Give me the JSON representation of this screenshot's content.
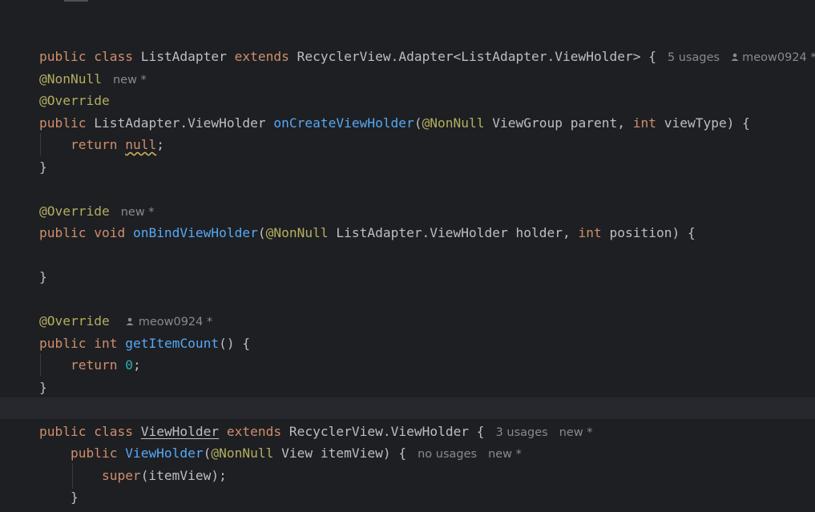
{
  "colors": {
    "background": "#1e1f22",
    "keyword": "#cf8e6d",
    "annotation": "#b3ae60",
    "method": "#56a8f5",
    "number": "#2aacb8",
    "text": "#bcbec4",
    "hint": "#868a91"
  },
  "code": {
    "class_decl": {
      "kw_public": "public",
      "kw_class": "class",
      "name": "ListAdapter",
      "kw_extends": "extends",
      "parent": "RecyclerView.Adapter<ListAdapter.ViewHolder>",
      "brace": "{",
      "hint_usages": "5 usages",
      "hint_author": "meow0924 *"
    },
    "m1": {
      "ann_nonnull": "@NonNull",
      "hint_new": "new *",
      "ann_override": "@Override",
      "kw_public": "public",
      "return_type": "ListAdapter.ViewHolder",
      "name": "onCreateViewHolder",
      "open_paren": "(",
      "param_ann": "@NonNull",
      "param1": "ViewGroup parent,",
      "kw_int": "int",
      "param2": "viewType) {",
      "kw_return": "return",
      "ret_val": "null",
      "semicolon": ";",
      "close": "}"
    },
    "m2": {
      "ann_override": "@Override",
      "hint_new": "new *",
      "kw_public": "public",
      "kw_void": "void",
      "name": "onBindViewHolder",
      "open_paren": "(",
      "param_ann": "@NonNull",
      "param1": "ListAdapter.ViewHolder holder,",
      "kw_int": "int",
      "param2": "position) {",
      "close": "}"
    },
    "m3": {
      "ann_override": "@Override",
      "hint_author": "meow0924 *",
      "kw_public": "public",
      "kw_int": "int",
      "name": "getItemCount",
      "rest": "() {",
      "kw_return": "return",
      "ret_val": "0",
      "semicolon": ";",
      "close": "}"
    },
    "inner_class": {
      "kw_public": "public",
      "kw_class": "class",
      "name": "ViewHolder",
      "kw_extends": "extends",
      "parent": "RecyclerView.ViewHolder {",
      "hint_usages": "3 usages",
      "hint_new": "new *",
      "ctor_public": "public",
      "ctor_name": "ViewHolder",
      "ctor_open": "(",
      "ctor_ann": "@NonNull",
      "ctor_params": "View itemView) {",
      "ctor_hint_usages": "no usages",
      "ctor_hint_new": "new *",
      "super_call": "super",
      "super_args": "(itemView);",
      "close": "}"
    }
  }
}
